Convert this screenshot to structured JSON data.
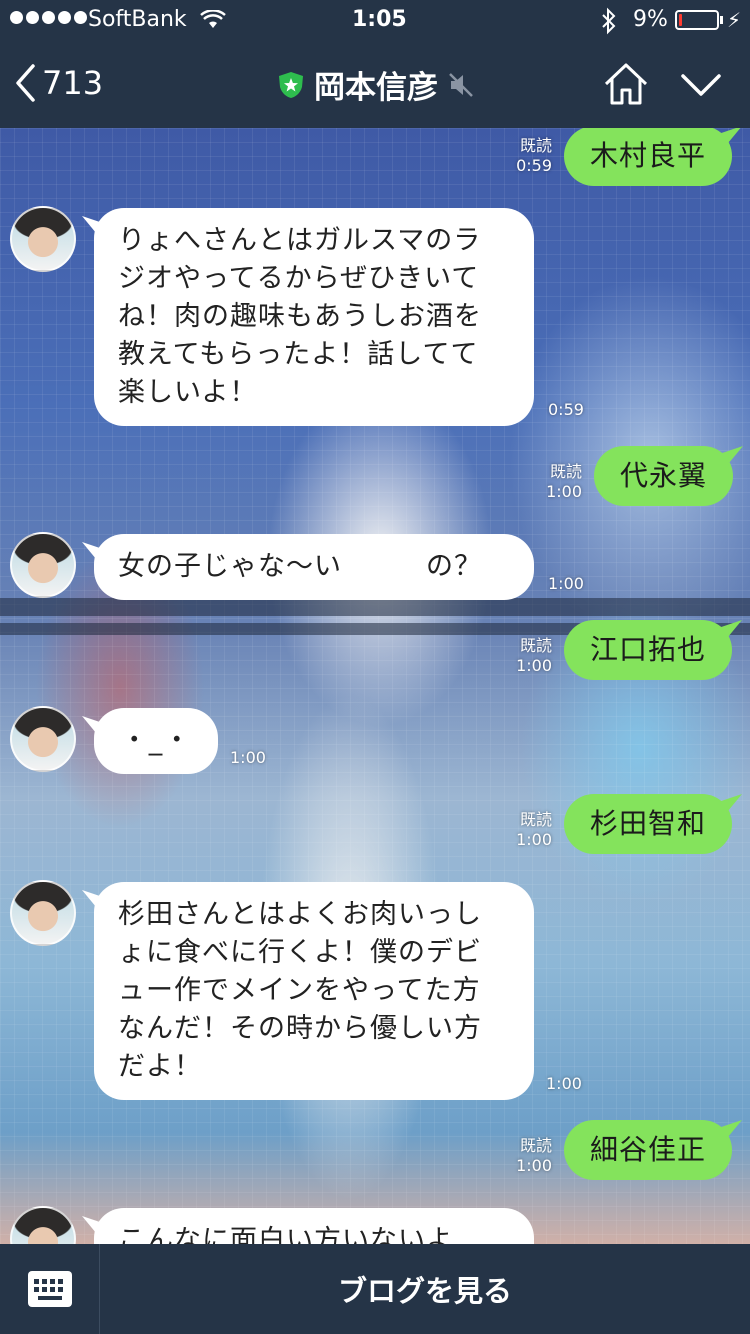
{
  "status_bar": {
    "carrier": "SoftBank",
    "time": "1:05",
    "battery": "9%",
    "battery_level": 0.09,
    "icons": [
      "signal-dots-icon",
      "wifi-icon",
      "bluetooth-icon",
      "battery-icon",
      "charging-bolt-icon"
    ]
  },
  "nav": {
    "back_count": "713",
    "title": "岡本信彦",
    "icons": [
      "back-chevron-icon",
      "official-star-shield-icon",
      "mute-speaker-icon",
      "home-icon",
      "chevron-down-icon"
    ]
  },
  "messages": [
    {
      "side": "right",
      "text": "木村良平",
      "read": "既読",
      "time": "0:59"
    },
    {
      "side": "left",
      "text": "りょへさんとはガルスマのラジオやってるからぜひきいてね！肉の趣味もあうしお酒を教えてもらったよ！話してて楽しいよ！",
      "lines": [
        "りょへさんとはガルスマのラ",
        "ジオやってるからぜひきいて",
        "ね！肉の趣味もあうしお酒を",
        "教えてもらったよ！話してて",
        "楽しいよ！"
      ],
      "time": "0:59"
    },
    {
      "side": "right",
      "text": "代永翼",
      "read": "既読",
      "time": "1:00"
    },
    {
      "side": "left",
      "text": "女の子じゃな〜い　　　の？",
      "lines": [
        "女の子じゃな〜い　　　の？"
      ],
      "time": "1:00"
    },
    {
      "side": "right",
      "text": "江口拓也",
      "read": "既読",
      "time": "1:00"
    },
    {
      "side": "left",
      "text": "・_・",
      "lines": [
        "・_・"
      ],
      "time": "1:00"
    },
    {
      "side": "right",
      "text": "杉田智和",
      "read": "既読",
      "time": "1:00"
    },
    {
      "side": "left",
      "text": "杉田さんとはよくお肉いっしょに食べに行くよ！僕のデビュー作でメインをやってた方なんだ！その時から優しい方だよ！",
      "lines": [
        "杉田さんとはよくお肉いっし",
        "ょに食べに行くよ！僕のデビ",
        "ュー作でメインをやってた方",
        "なんだ！その時から優しい方",
        "だよ！"
      ],
      "time": "1:00"
    },
    {
      "side": "right",
      "text": "細谷佳正",
      "read": "既読",
      "time": "1:00"
    },
    {
      "side": "left",
      "text": "こんなに面白い方いないよ",
      "lines": [
        "こんなに面白い方いないよ"
      ],
      "time": ""
    }
  ],
  "bottom": {
    "keyboard_icon": "keyboard-icon",
    "blog_button": "ブログを見る"
  },
  "colors": {
    "bar_bg": "#253447",
    "sent_bubble": "#84e35c",
    "received_bubble": "#ffffff",
    "battery_low": "#ff3b30"
  }
}
